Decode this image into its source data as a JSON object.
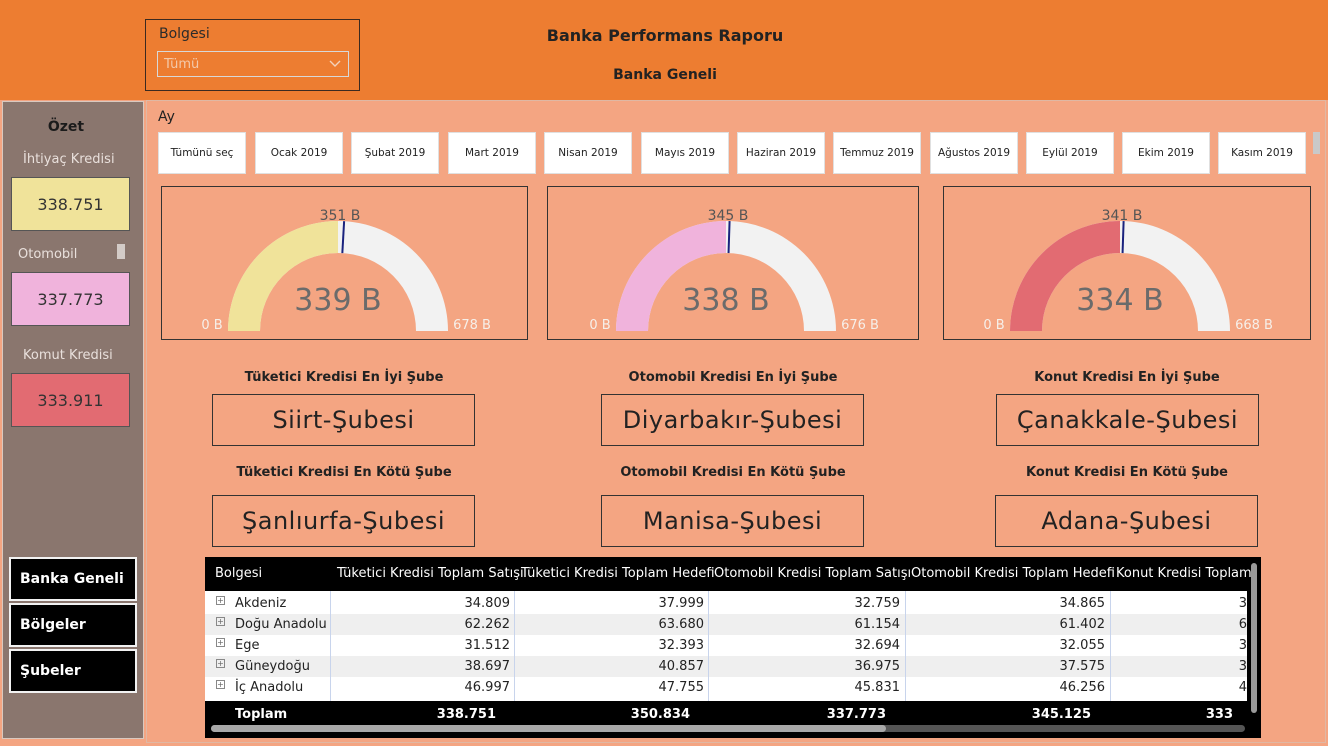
{
  "header": {
    "title": "Banka Performans Raporu",
    "subtitle": "Banka Geneli",
    "region_slicer": {
      "label": "Bolgesi",
      "value": "Tümü"
    }
  },
  "sidebar": {
    "title": "Özet",
    "kpis": [
      {
        "label": "İhtiyaç Kredisi",
        "value": "338.751",
        "color": "#f0e39a"
      },
      {
        "label": "Otomobil",
        "value": "337.773",
        "color": "#f0b3dc"
      },
      {
        "label": "Komut Kredisi",
        "value": "333.911",
        "color": "#e26b72"
      }
    ],
    "nav": [
      "Banka Geneli",
      "Bölgeler",
      "Şubeler"
    ]
  },
  "month_slicer": {
    "label": "Ay",
    "items": [
      "Tümünü seç",
      "Ocak 2019",
      "Şubat 2019",
      "Mart 2019",
      "Nisan 2019",
      "Mayıs 2019",
      "Haziran 2019",
      "Temmuz 2019",
      "Ağustos 2019",
      "Eylül 2019",
      "Ekim 2019",
      "Kasım 2019"
    ]
  },
  "gauges": [
    {
      "value_label": "339 B",
      "target_label": "351 B",
      "min_label": "0 B",
      "max_label": "678 B",
      "value": 339,
      "target": 351,
      "min": 0,
      "max": 678,
      "color": "#f0e39a"
    },
    {
      "value_label": "338 B",
      "target_label": "345 B",
      "min_label": "0 B",
      "max_label": "676 B",
      "value": 338,
      "target": 345,
      "min": 0,
      "max": 676,
      "color": "#f0b3dc"
    },
    {
      "value_label": "334 B",
      "target_label": "341 B",
      "min_label": "0 B",
      "max_label": "668 B",
      "value": 334,
      "target": 341,
      "min": 0,
      "max": 668,
      "color": "#e26b72"
    }
  ],
  "branches": {
    "best": [
      {
        "title": "Tüketici Kredisi En İyi Şube",
        "name": "Siirt-Şubesi"
      },
      {
        "title": "Otomobil Kredisi En İyi Şube",
        "name": "Diyarbakır-Şubesi"
      },
      {
        "title": "Konut Kredisi En İyi Şube",
        "name": "Çanakkale-Şubesi"
      }
    ],
    "worst": [
      {
        "title": "Tüketici Kredisi En Kötü Şube",
        "name": "Şanlıurfa-Şubesi"
      },
      {
        "title": "Otomobil Kredisi En Kötü Şube",
        "name": "Manisa-Şubesi"
      },
      {
        "title": "Konut Kredisi En Kötü Şube",
        "name": "Adana-Şubesi"
      }
    ]
  },
  "table": {
    "columns": [
      "Bolgesi",
      "Tüketici Kredisi Toplam Satışı",
      "Tüketici Kredisi Toplam Hedefi",
      "Otomobil Kredisi Toplam Satışı",
      "Otomobil Kredisi Toplam Hedefi",
      "Konut Kredisi Toplam"
    ],
    "rows": [
      {
        "region": "Akdeniz",
        "c1": "34.809",
        "c2": "37.999",
        "c3": "32.759",
        "c4": "34.865",
        "c5": "3"
      },
      {
        "region": "Doğu Anadolu",
        "c1": "62.262",
        "c2": "63.680",
        "c3": "61.154",
        "c4": "61.402",
        "c5": "6"
      },
      {
        "region": "Ege",
        "c1": "31.512",
        "c2": "32.393",
        "c3": "32.694",
        "c4": "32.055",
        "c5": "3"
      },
      {
        "region": "Güneydoğu",
        "c1": "38.697",
        "c2": "40.857",
        "c3": "36.975",
        "c4": "37.575",
        "c5": "3"
      },
      {
        "region": "İç Anadolu",
        "c1": "46.997",
        "c2": "47.755",
        "c3": "45.831",
        "c4": "46.256",
        "c5": "4"
      }
    ],
    "total": {
      "label": "Toplam",
      "c1": "338.751",
      "c2": "350.834",
      "c3": "337.773",
      "c4": "345.125",
      "c5": "333"
    }
  }
}
